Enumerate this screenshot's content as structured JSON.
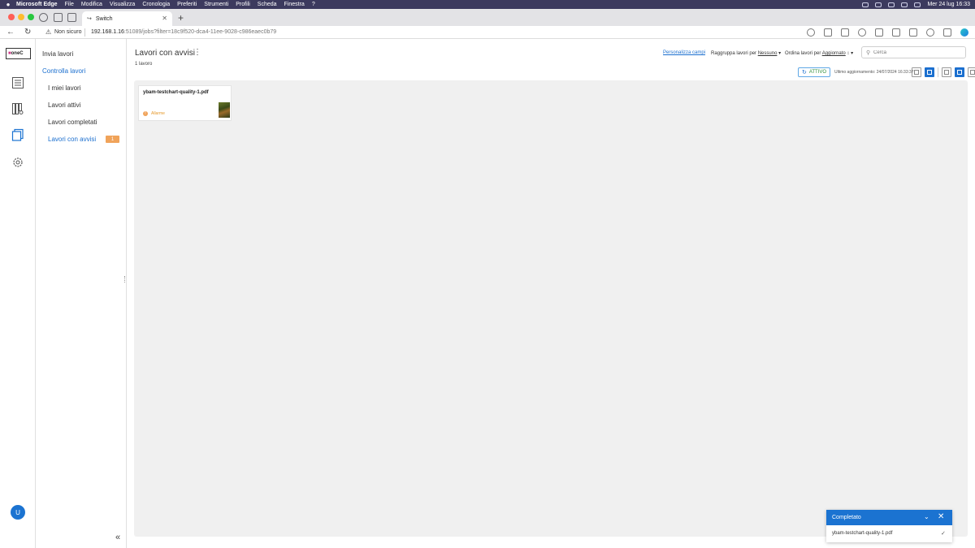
{
  "menubar": {
    "items": [
      "Microsoft Edge",
      "File",
      "Modifica",
      "Visualizza",
      "Cronologia",
      "Preferiti",
      "Strumenti",
      "Profili",
      "Scheda",
      "Finestra",
      "?"
    ],
    "clock": "Mer 24 lug  16:33"
  },
  "browser": {
    "tab_title": "Switch",
    "not_secure": "Non sicuro",
    "url_host": "192.168.1.16",
    "url_rest": ":51089/jobs?filter=18c9f520-dca4-11ee-9028-c986eaec0b79",
    "traffic_colors": [
      "#ff5f57",
      "#febc2e",
      "#28c840"
    ]
  },
  "logo": {
    "text": "oneC"
  },
  "sidebar": {
    "submit": "Invia lavori",
    "check": "Controlla lavori",
    "items": [
      {
        "label": "I miei lavori"
      },
      {
        "label": "Lavori attivi"
      },
      {
        "label": "Lavori completati"
      },
      {
        "label": "Lavori con avvisi",
        "badge": "1"
      }
    ]
  },
  "user": {
    "initial": "U"
  },
  "main": {
    "title": "Lavori con avvisi",
    "count": "1 lavoro",
    "customize": "Personalizza campi",
    "group_label": "Raggruppa lavori per",
    "group_value": "Nessuno",
    "sort_label": "Ordina lavori per",
    "sort_value": "Aggiornato",
    "search_placeholder": "Cerca",
    "active_label": "ATTIVO",
    "last_update": "Ultimo aggiornamento: 24/07/2024 16:33:37"
  },
  "jobs": [
    {
      "name": "ybam-testchart-quality-1.pdf",
      "status": "Allarme"
    }
  ],
  "toast": {
    "title": "Completato",
    "file": "ybam-testchart-quality-1.pdf"
  },
  "colors": {
    "accent": "#1b73d1",
    "warning": "#f0a35a",
    "menubar": "#3c3a5e"
  }
}
